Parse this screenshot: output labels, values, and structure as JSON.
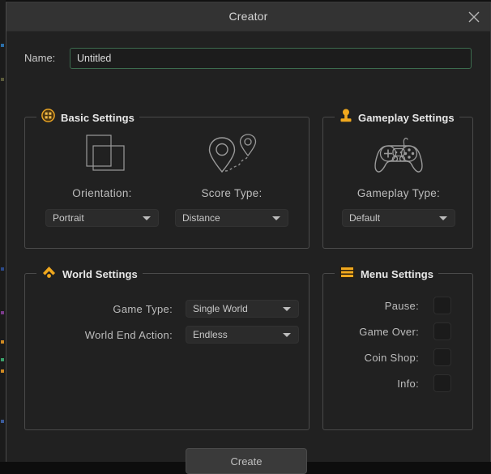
{
  "window": {
    "title": "Creator",
    "close_icon": "close-icon"
  },
  "name_field": {
    "label": "Name:",
    "value": "Untitled",
    "placeholder": "Untitled"
  },
  "groups": {
    "basic": {
      "title": "Basic Settings",
      "icon": "grid-circle-icon",
      "icon_color": "#e8a324",
      "columns": [
        {
          "icon": "orientation-rectangles-icon",
          "label": "Orientation:",
          "dropdown": {
            "value": "Portrait",
            "arrow_icon": "chevron-down-icon"
          }
        },
        {
          "icon": "map-pin-route-icon",
          "label": "Score Type:",
          "dropdown": {
            "value": "Distance",
            "arrow_icon": "chevron-down-icon"
          }
        }
      ]
    },
    "gameplay": {
      "title": "Gameplay Settings",
      "icon": "joystick-icon",
      "icon_color": "#f0a81e",
      "columns": [
        {
          "icon": "gamepad-icon",
          "label": "Gameplay Type:",
          "dropdown": {
            "value": "Default",
            "arrow_icon": "chevron-down-icon"
          }
        }
      ]
    },
    "world": {
      "title": "World Settings",
      "icon": "chevron-up-dot-icon",
      "icon_color": "#f0a81e",
      "fields": [
        {
          "label": "Game Type:",
          "value": "Single World",
          "arrow_icon": "chevron-down-icon"
        },
        {
          "label": "World End Action:",
          "value": "Endless",
          "arrow_icon": "chevron-down-icon"
        }
      ]
    },
    "menu": {
      "title": "Menu Settings",
      "icon": "hamburger-icon",
      "icon_color": "#f0a81e",
      "checkboxes": [
        {
          "label": "Pause:",
          "checked": false
        },
        {
          "label": "Game Over:",
          "checked": false
        },
        {
          "label": "Coin Shop:",
          "checked": false
        },
        {
          "label": "Info:",
          "checked": false
        }
      ]
    }
  },
  "footer": {
    "create_label": "Create"
  },
  "colors": {
    "accent": "#f0a81e",
    "window_bg": "#212121",
    "titlebar_bg": "#333333",
    "input_focus_border": "#3c6b4e",
    "text_primary": "#e8e8e8",
    "text_secondary": "#bdbdbd"
  }
}
